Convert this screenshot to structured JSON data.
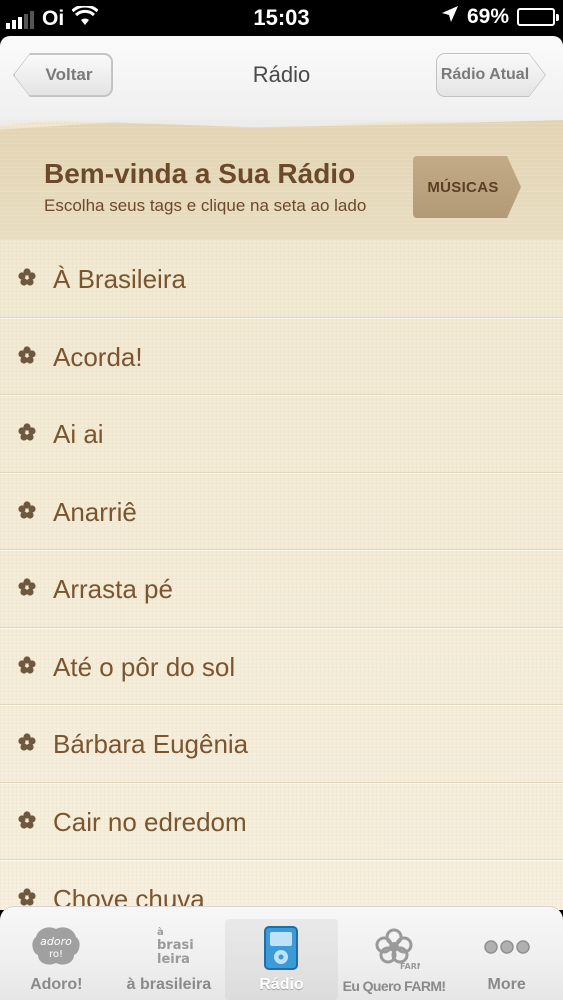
{
  "status_bar": {
    "carrier": "Oi",
    "time": "15:03",
    "battery": "69%",
    "battery_level": 0.69
  },
  "nav_bar": {
    "title": "Rádio",
    "back_label": "Voltar",
    "right_label": "Rádio Atual"
  },
  "welcome": {
    "title": "Bem-vinda a Sua Rádio",
    "subtitle": "Escolha seus tags e clique na seta ao lado",
    "button_label": "MÚSICAS"
  },
  "tags": [
    "À Brasileira",
    "Acorda!",
    "Ai ai",
    "Anarriê",
    "Arrasta pé",
    "Até o pôr do sol",
    "Bárbara Eugênia",
    "Cair no edredom",
    "Chove chuva"
  ],
  "tab_bar": {
    "active_index": 2,
    "tabs": [
      {
        "label": "Adoro!",
        "icon": "adoro-icon"
      },
      {
        "label": "à brasileira",
        "icon": "a-brasileira-icon"
      },
      {
        "label": "Rádio",
        "icon": "radio-player-icon"
      },
      {
        "label": "Eu Quero FARM!",
        "icon": "farm-flower-icon"
      },
      {
        "label": "More",
        "icon": "more-dots-icon"
      }
    ]
  },
  "colors": {
    "paper": "#f3ecd9",
    "brown_text": "#7a5530",
    "header_bg": "#e4d7b8",
    "accent_blue": "#3a9bd8"
  }
}
